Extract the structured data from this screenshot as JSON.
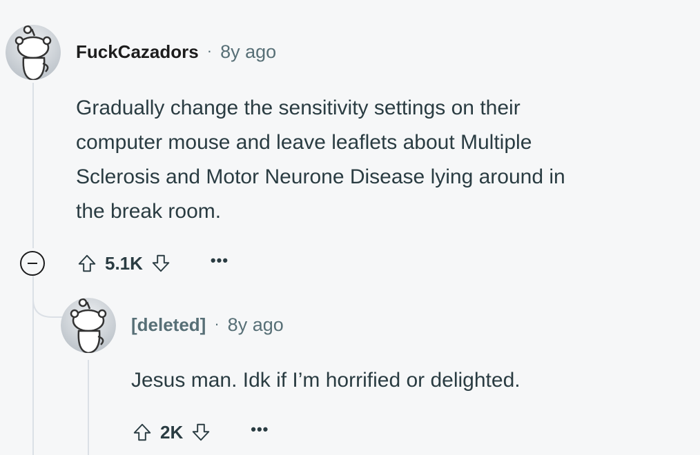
{
  "comments": [
    {
      "author": "FuckCazadors",
      "separator": "·",
      "time": "8y ago",
      "body_lines": [
        "Gradually change the sensitivity settings on their",
        "computer mouse and leave leaflets about Multiple",
        "Sclerosis and Motor Neurone Disease lying around in",
        "the break room."
      ],
      "score": "5.1K",
      "more": "•••",
      "avatar_icon": "snoo-avatar-icon"
    },
    {
      "author": "[deleted]",
      "separator": "·",
      "time": "8y ago",
      "body_lines": [
        "Jesus man. Idk if I’m horrified or delighted."
      ],
      "score": "2K",
      "more": "•••",
      "avatar_icon": "snoo-avatar-icon"
    }
  ],
  "colors": {
    "background": "#f6f7f8",
    "thread_line": "#dbe0e6",
    "meta_text": "#576f76",
    "body_text": "#2a3c42"
  }
}
